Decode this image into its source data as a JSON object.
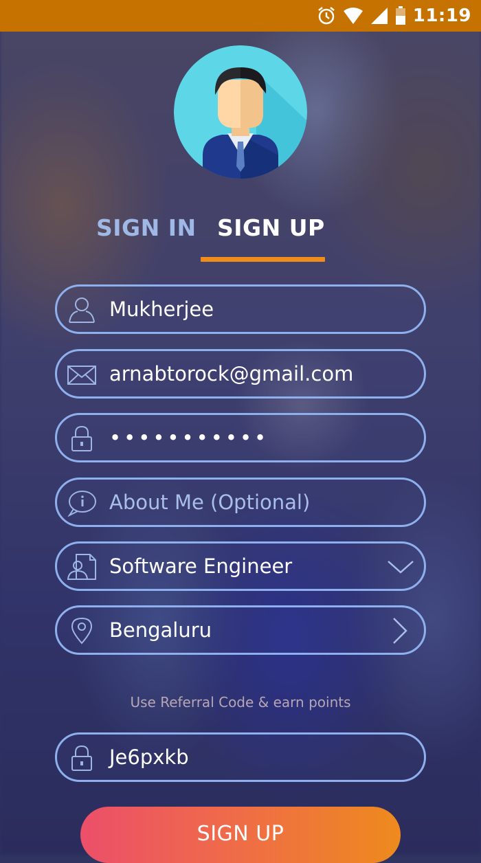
{
  "status_bar": {
    "time": "11:19",
    "icons": [
      "alarm-icon",
      "wifi-icon",
      "signal-icon",
      "battery-icon"
    ],
    "background": "#c57200"
  },
  "tabs": {
    "sign_in": "SIGN IN",
    "sign_up": "SIGN UP",
    "active": "SIGN UP",
    "underline_color": "#f08c1a"
  },
  "form": {
    "name": {
      "icon": "user-icon",
      "value": "Mukherjee"
    },
    "email": {
      "icon": "envelope-icon",
      "value": "arnabtorock@gmail.com"
    },
    "password": {
      "icon": "lock-icon",
      "value": "•••••••••••"
    },
    "about": {
      "icon": "info-chat-icon",
      "placeholder": "About Me (Optional)"
    },
    "profession": {
      "icon": "profile-document-icon",
      "value": "Software Engineer",
      "trailing_icon": "chevron-down-icon"
    },
    "city": {
      "icon": "location-pin-icon",
      "value": "Bengaluru",
      "trailing_icon": "chevron-right-icon"
    },
    "referral_note": "Use Referral Code & earn points",
    "referral": {
      "icon": "lock-icon",
      "value": "Je6pxkb"
    }
  },
  "submit": {
    "label": "SIGN UP",
    "gradient": [
      "#ec4f6a",
      "#ee8a1e"
    ]
  },
  "accent_border": "#8fb0ee"
}
